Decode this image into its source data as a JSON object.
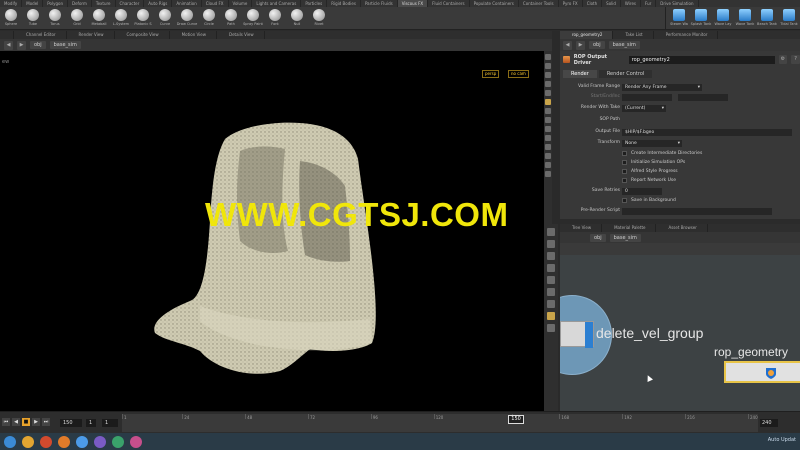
{
  "shelf": {
    "tabs": [
      "Modify",
      "Model",
      "Polygon",
      "Deform",
      "Texture",
      "Character",
      "Auto Rigs",
      "Animation",
      "Cloud FX",
      "Volume",
      "Lights and Cameras",
      "Particles",
      "Rigid Bodies",
      "Particle Fluids",
      "Viscous FX",
      "Fluid Containers",
      "Populate Containers",
      "Container Tools",
      "Pyro FX",
      "Cloth",
      "Solid",
      "Wires",
      "Fur",
      "Drive Simulation"
    ],
    "active_tab": "Viscous FX",
    "tools_left": [
      {
        "label": "Sphere",
        "icon": "sphere-icon"
      },
      {
        "label": "Tube",
        "icon": "tube-icon"
      },
      {
        "label": "Torus",
        "icon": "torus-icon"
      },
      {
        "label": "Grid",
        "icon": "grid-icon"
      },
      {
        "label": "Metaball",
        "icon": "metaball-icon"
      },
      {
        "label": "L-System",
        "icon": "lsystem-icon"
      },
      {
        "label": "Platonic S",
        "icon": "platonic-icon"
      },
      {
        "label": "Curve",
        "icon": "curve-icon"
      },
      {
        "label": "Draw Curve",
        "icon": "draw-curve-icon"
      },
      {
        "label": "Circle",
        "icon": "circle-icon"
      },
      {
        "label": "Path",
        "icon": "path-icon"
      },
      {
        "label": "Spray Paint",
        "icon": "spray-icon"
      },
      {
        "label": "Font",
        "icon": "font-icon"
      },
      {
        "label": "Null",
        "icon": "null-icon"
      },
      {
        "label": "Rivet",
        "icon": "rivet-icon"
      }
    ],
    "tools_right": [
      {
        "label": "Steam Wa",
        "icon": "steam-icon"
      },
      {
        "label": "Splash Tank",
        "icon": "splash-tank-icon"
      },
      {
        "label": "Wave Lay",
        "icon": "wave-layer-icon"
      },
      {
        "label": "Wave Tank",
        "icon": "wave-tank-icon"
      },
      {
        "label": "Beach Tank",
        "icon": "beach-tank-icon"
      },
      {
        "label": "Tidal Tank",
        "icon": "tidal-tank-icon"
      }
    ]
  },
  "left_pane": {
    "tabs": [
      "Channel Editor",
      "Render View",
      "Composite View",
      "Motion View",
      "Details View"
    ],
    "path": "obj",
    "node": "base_sim",
    "viewport_label": "ew",
    "cam_persp": "persp",
    "cam_no": "no cam"
  },
  "watermark": "WWW.CGTSJ.COM",
  "timeline": {
    "start": "1",
    "current": "150",
    "step": "1",
    "end": "240",
    "ticks": [
      "1",
      "24",
      "48",
      "72",
      "96",
      "120",
      "150",
      "168",
      "192",
      "216",
      "240"
    ],
    "current_frame_box": "150"
  },
  "right_pane": {
    "tabs": [
      "rop_geometry2",
      "Take List",
      "Performance Monitor"
    ],
    "path": "obj",
    "node": "base_sim",
    "rop_type": "ROP Output Driver",
    "rop_name": "rop_geometry2",
    "param_tabs": [
      "Render",
      "Render Control"
    ],
    "params": {
      "valid_frame_range_label": "Valid Frame Range",
      "valid_frame_range_value": "Render Any Frame",
      "start_end_inc_label": "Start/End/Inc",
      "render_with_take_label": "Render With Take",
      "render_with_take_value": "(Current)",
      "sop_path_label": "SOP Path",
      "output_file_label": "Output File",
      "output_file_value": "$HIP/$F.bgeo",
      "transform_label": "Transform",
      "transform_value": "None",
      "checks": [
        "Create Intermediate Directories",
        "Initialize Simulation OPs",
        "Alfred Style Progress",
        "Report Network Use"
      ],
      "save_retries_label": "Save Retries",
      "save_retries_value": "0",
      "save_in_background": "Save in Background",
      "pre_render_script_label": "Pre-Render Script"
    },
    "net_tabs": [
      "Tree View",
      "Material Palette",
      "Asset Browser"
    ],
    "net_path": "obj",
    "net_node": "base_sim",
    "node_delete": "delete_vel_group",
    "node_rop": "rop_geometry"
  },
  "taskbar": {
    "tray_text": "Auto Updat"
  }
}
